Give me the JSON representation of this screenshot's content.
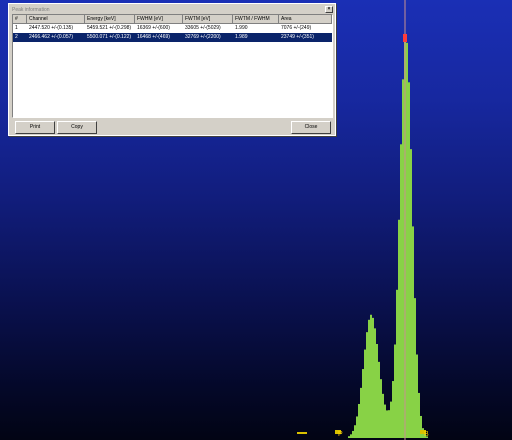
{
  "window": {
    "title": "Peak information",
    "close_glyph": "×"
  },
  "table": {
    "columns": [
      "#",
      "Channel",
      "Energy [keV]",
      "FWHM [eV]",
      "FWTM [eV]",
      "FWTM / FWHM",
      "Area"
    ],
    "rows": [
      {
        "cells": [
          "1",
          "2447.520 +/-(0.135)",
          "5459.521 +/-(0.298)",
          "16369 +/-(600)",
          "33605 +/-(5029)",
          "1.990",
          "7076 +/-(249)"
        ],
        "selected": false
      },
      {
        "cells": [
          "2",
          "2466.462 +/-(0.057)",
          "5500.071 +/-(0.122)",
          "16468 +/-(469)",
          "32769 +/-(2200)",
          "1.989",
          "23749 +/-(351)"
        ],
        "selected": true
      }
    ]
  },
  "buttons": {
    "print": "Print",
    "copy": "Copy",
    "close": "Close"
  },
  "spectrum": {
    "bar_color": "#88d246",
    "cursor_color": "#c89090",
    "peak_marker_color": "#ff3b3b"
  }
}
